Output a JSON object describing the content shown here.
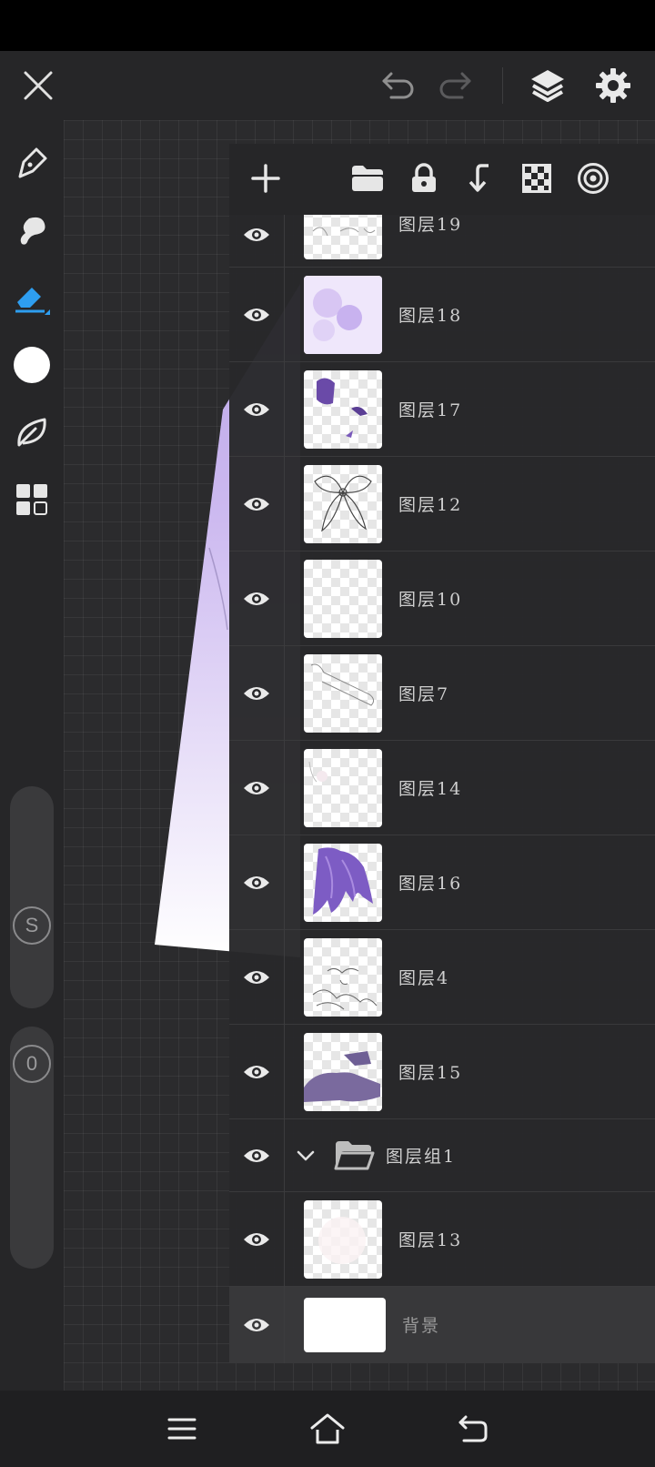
{
  "layers_panel": {
    "layers": [
      {
        "name": "图层19",
        "visible": true
      },
      {
        "name": "图层18",
        "visible": true
      },
      {
        "name": "图层17",
        "visible": true
      },
      {
        "name": "图层12",
        "visible": true
      },
      {
        "name": "图层10",
        "visible": true
      },
      {
        "name": "图层7",
        "visible": true
      },
      {
        "name": "图层14",
        "visible": true
      },
      {
        "name": "图层16",
        "visible": true
      },
      {
        "name": "图层4",
        "visible": true
      },
      {
        "name": "图层15",
        "visible": true
      }
    ],
    "group": {
      "name": "图层组1",
      "expanded": true,
      "visible": true
    },
    "group_layers": [
      {
        "name": "图层13",
        "visible": true
      }
    ],
    "background_layer": {
      "name": "背景",
      "visible": true
    }
  },
  "icons": {
    "top_bar": [
      "close-icon",
      "undo-icon",
      "redo-icon",
      "layers-icon",
      "settings-gear-icon"
    ],
    "layer_toolbar": [
      "add-layer-icon",
      "folder-icon",
      "lock-icon",
      "merge-down-icon",
      "alpha-checker-icon",
      "target-icon"
    ],
    "tools": [
      "pen-icon",
      "smudge-icon",
      "eraser-icon",
      "color-swatch",
      "leaf-brush-icon",
      "grid-menu-icon"
    ],
    "nav": [
      "menu-icon",
      "home-icon",
      "back-icon"
    ]
  },
  "colors": {
    "accent": "#2e9ef0",
    "panel": "#28282a",
    "toolbar": "#262628",
    "color_swatch": "#ffffff"
  },
  "tool_sliders": {
    "size_label": "S",
    "opacity_label": "0"
  }
}
